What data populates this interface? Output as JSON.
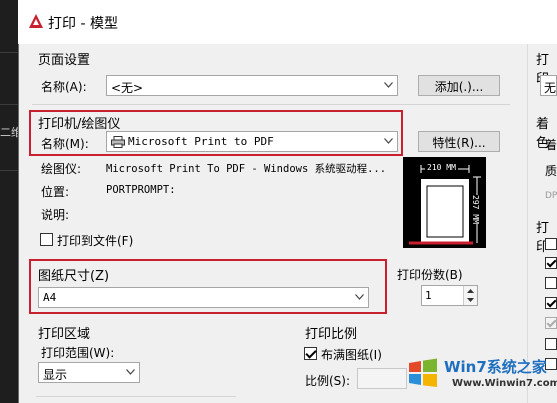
{
  "window": {
    "title": "打印 - 模型"
  },
  "background": {
    "cad_label": "二维"
  },
  "page_setup": {
    "group_title": "页面设置",
    "name_label": "名称(A):",
    "name_value": "<无>",
    "add_button": "添加(.)..."
  },
  "printer": {
    "group_title": "打印机/绘图仪",
    "name_label": "名称(M):",
    "name_value": "Microsoft Print to PDF",
    "properties_button": "特性(R)...",
    "plotter_label": "绘图仪:",
    "plotter_value": "Microsoft Print To PDF - Windows 系统驱动程...",
    "location_label": "位置:",
    "location_value": "PORTPROMPT:",
    "description_label": "说明:",
    "print_to_file_label": "打印到文件(F)",
    "print_to_file_checked": false,
    "preview_width": "210 MM",
    "preview_height": "297 MM"
  },
  "paper_size": {
    "group_title": "图纸尺寸(Z)",
    "value": "A4"
  },
  "copies": {
    "label": "打印份数(B)",
    "value": "1"
  },
  "plot_area": {
    "group_title": "打印区域",
    "range_label": "打印范围(W):",
    "range_value": "显示"
  },
  "plot_scale": {
    "group_title": "打印比例",
    "fit_label": "布满图纸(I)",
    "fit_checked": true,
    "scale_label": "比例(S):"
  },
  "right_panel": {
    "plot_style_label": "打印",
    "plot_style_value": "无",
    "shaded_label": "着色",
    "shaded_item1": "着",
    "shaded_item2": "质",
    "dpi_label": "DP",
    "options_label": "打印"
  },
  "watermark": {
    "brand": "Win7系统之家",
    "url": "Www.Winwin7.com"
  },
  "colors": {
    "highlight_red": "#c8202e",
    "title_icon_red": "#c8202e"
  }
}
